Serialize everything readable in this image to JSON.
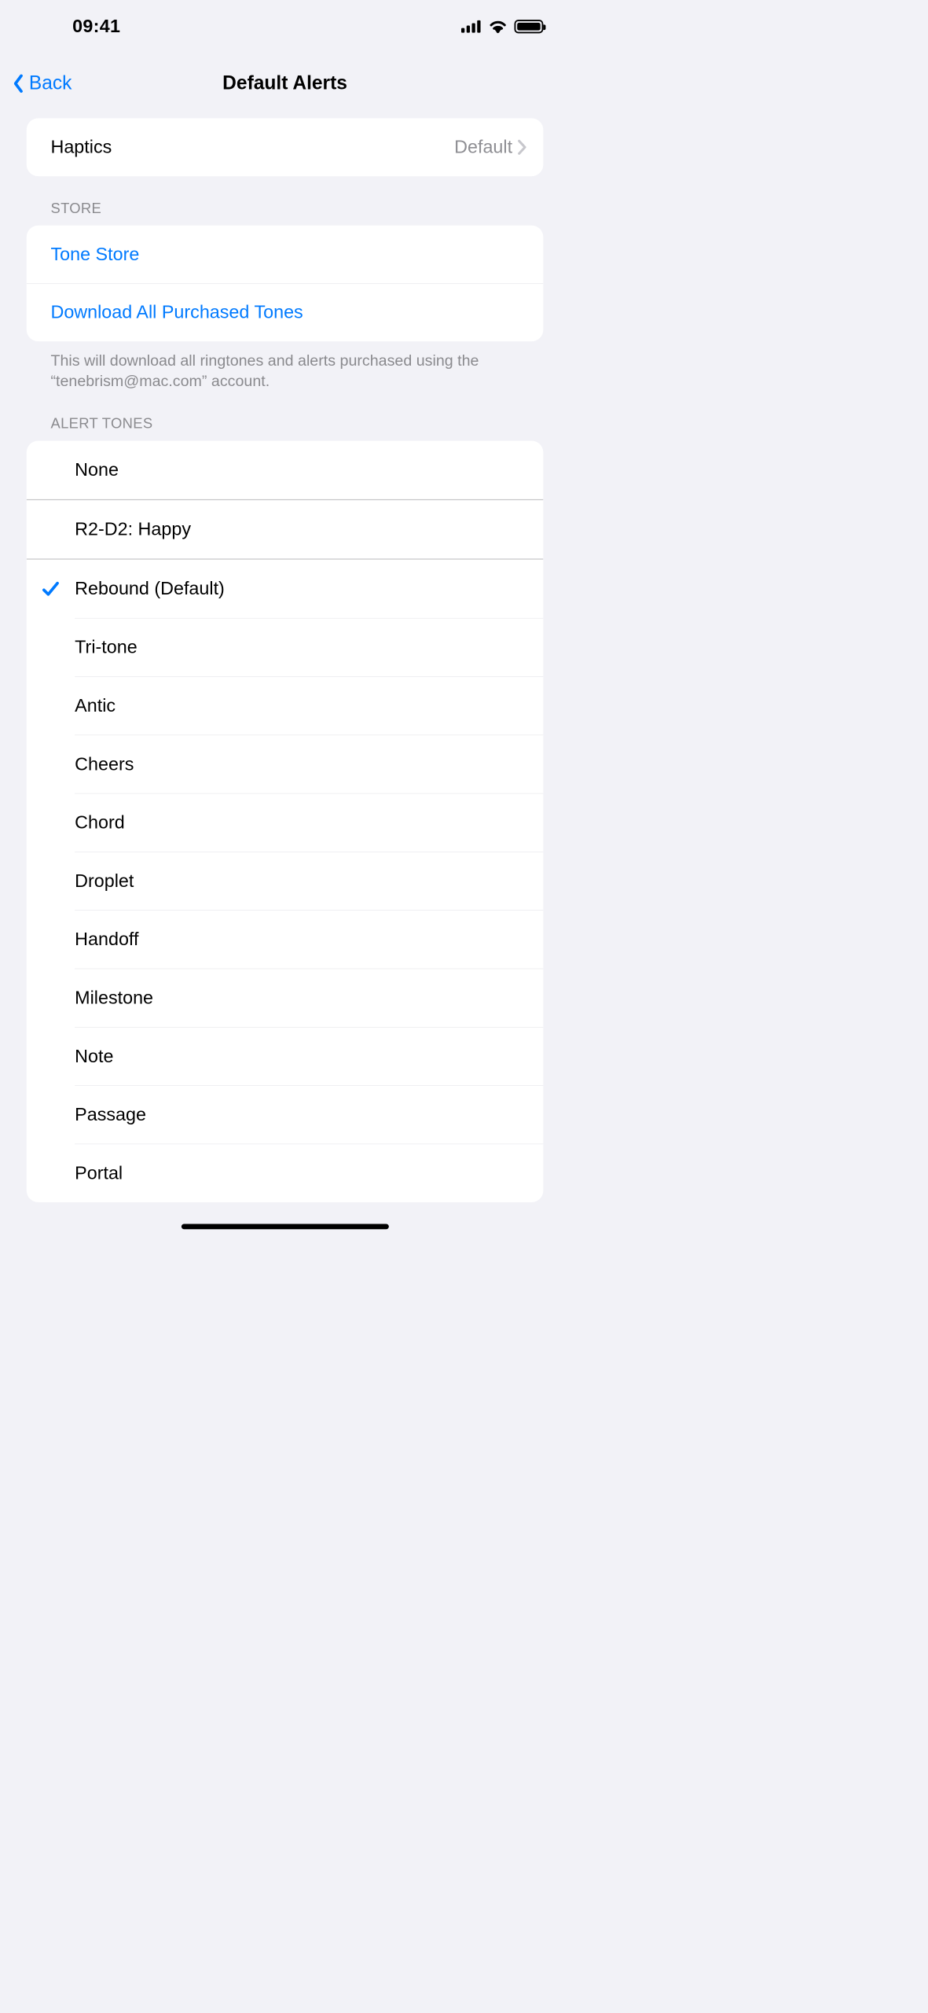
{
  "status": {
    "time": "09:41"
  },
  "nav": {
    "title": "Default Alerts",
    "back_label": "Back"
  },
  "section1": {
    "haptics_label": "Haptics",
    "haptics_value": "Default"
  },
  "section2": {
    "header": "Store",
    "tone_store_label": "Tone Store",
    "download_label": "Download All Purchased Tones",
    "footer": "This will download all ringtones and alerts purchased using the “tenebrism@mac.com” account."
  },
  "section3": {
    "header": "Alert Tones",
    "tones": [
      {
        "label": "None",
        "selected": false,
        "sep": "none"
      },
      {
        "label": "R2-D2: Happy",
        "selected": false,
        "sep": "thick"
      },
      {
        "label": "Rebound (Default)",
        "selected": true,
        "sep": "thick"
      },
      {
        "label": "Tri-tone",
        "selected": false,
        "sep": "thin"
      },
      {
        "label": "Antic",
        "selected": false,
        "sep": "thin"
      },
      {
        "label": "Cheers",
        "selected": false,
        "sep": "thin"
      },
      {
        "label": "Chord",
        "selected": false,
        "sep": "thin"
      },
      {
        "label": "Droplet",
        "selected": false,
        "sep": "thin"
      },
      {
        "label": "Handoff",
        "selected": false,
        "sep": "thin"
      },
      {
        "label": "Milestone",
        "selected": false,
        "sep": "thin"
      },
      {
        "label": "Note",
        "selected": false,
        "sep": "thin"
      },
      {
        "label": "Passage",
        "selected": false,
        "sep": "thin"
      },
      {
        "label": "Portal",
        "selected": false,
        "sep": "thin"
      }
    ]
  }
}
